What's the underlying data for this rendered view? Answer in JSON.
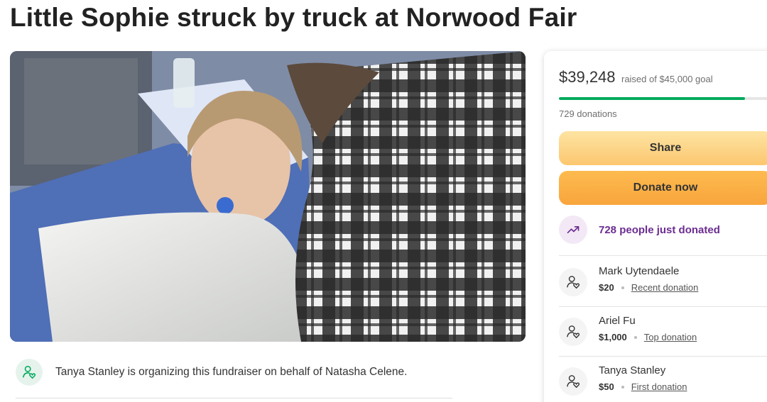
{
  "page": {
    "title": "Little Sophie struck by truck at Norwood Fair"
  },
  "organizer": {
    "text": "Tanya Stanley is organizing this fundraiser on behalf of Natasha Celene.",
    "icon": "user-heart-icon"
  },
  "campaign": {
    "raised": "$39,248",
    "goal_text": "raised of $45,000 goal",
    "progress_fraction": 0.872,
    "donations_count": "729 donations",
    "share_label": "Share",
    "donate_label": "Donate now",
    "recent_activity": "728 people just donated",
    "accent_color": "#02a95c",
    "activity_color": "#6b2c91"
  },
  "donors": [
    {
      "name": "Mark Uytendaele",
      "amount": "$20",
      "tag": "Recent donation"
    },
    {
      "name": "Ariel Fu",
      "amount": "$1,000",
      "tag": "Top donation"
    },
    {
      "name": "Tanya Stanley",
      "amount": "$50",
      "tag": "First donation"
    }
  ]
}
